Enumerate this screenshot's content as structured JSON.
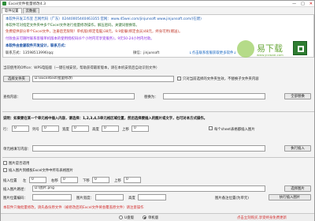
{
  "window": {
    "title": "Excel文件批量修改4.3",
    "min": "—",
    "max": "□",
    "close": "✕"
  },
  "tabs": [
    {
      "label": "软件设置"
    },
    {
      "label": "云数据"
    }
  ],
  "banner": {
    "line1": "本软件开发工作室 吉网代码（广东）02440005440463355 官网：www.45wei.com/jinjunsoft   www.jinjunsoft.com/(在建)",
    "line2": "本软件可对指定文件夹中多个Excel文件进行批量修改操作，解压密码，关键词替换等。",
    "line3": "免费提供部分单个Excel文件，注册后无限制！单机版(绑定电脑)38元，9.9套餐(绑定会员)48元，终身可用(赠送)。",
    "line4": "付款会员可随时联系客服单机版本的使用授权码(6个小时内可享受服务)，9元50-24小时内付款。",
    "line5": "本软件由金骏软件开发设计，联系方式：",
    "phone_label": "联系方式：13598513996(qq:",
    "wechat": "微信：jinjunsoft",
    "promo": "↓点击联系客服获取更多软件↓"
  },
  "watermark": {
    "brand": "易下载",
    "sub": "www.yixiazai.com"
  },
  "info": "当前使用的Office：WPS电脑版（一键在线安装，帮助获得最新版本，请在本机安装后自动识别文件）",
  "file_row": {
    "select_label": "选择文件夹",
    "path": "D:\\excel\\test\\批量修改\\",
    "sub_check_label": "只对当前选择的文件夹生效，不替换子文件夹内容"
  },
  "find_row": {
    "find_label": "查找内容：",
    "find_value": "",
    "replace_label": "替换为：",
    "replace_value": "",
    "btn": "全部替换"
  },
  "instr": "说明：如果要在某一个单元格中插入内容，请选择：1,2,3,4,5单元格区域位置，然后选择要插入的图片或文字，也可对本方式操作。",
  "pos_row": {
    "row_label": "行：",
    "row_value": "0",
    "col_label": "列号",
    "col_value": "0",
    "width_label": "宽度",
    "width_value": "0",
    "height_label": "高度",
    "height_value": "0",
    "top_label": "上移",
    "top_value": "0",
    "sheet_check": "每个sheet表格都插入图片"
  },
  "cell_row": {
    "label": "单元格填写内容：",
    "value": "",
    "btn": "执行插入"
  },
  "img_check": {
    "cb1": "图片是否适用",
    "cb2": "插入图片到模板Excel文件中所有表格图片"
  },
  "img_pos": {
    "insert_label": "插入位置",
    "left_label": "左",
    "left_value": "0",
    "right_label": "右移",
    "right_value": "0",
    "down_label": "下移",
    "down_value": "0",
    "up_label": "上移",
    "up_value": "0"
  },
  "img_path_row": {
    "label": "插入图片路径：",
    "path": "D:\\图片.png",
    "btn": "选择图片"
  },
  "img_size_row": {
    "label": "图片位置编码：",
    "value": "",
    "width_label": "图片宽度：",
    "width_value": "",
    "height_label": "高度",
    "height_value": "",
    "note": "图片备注位置(为单元)",
    "btn": "执行插入图片"
  },
  "warn": "本软件只做批量修改，请先备份原文件（被修改后的Excel文件将会覆盖原文件）请注意操作",
  "status": {
    "radio1": "U盘版",
    "radio2": "单机版",
    "promo": "点击立刻购买,享受终身免费更新"
  }
}
